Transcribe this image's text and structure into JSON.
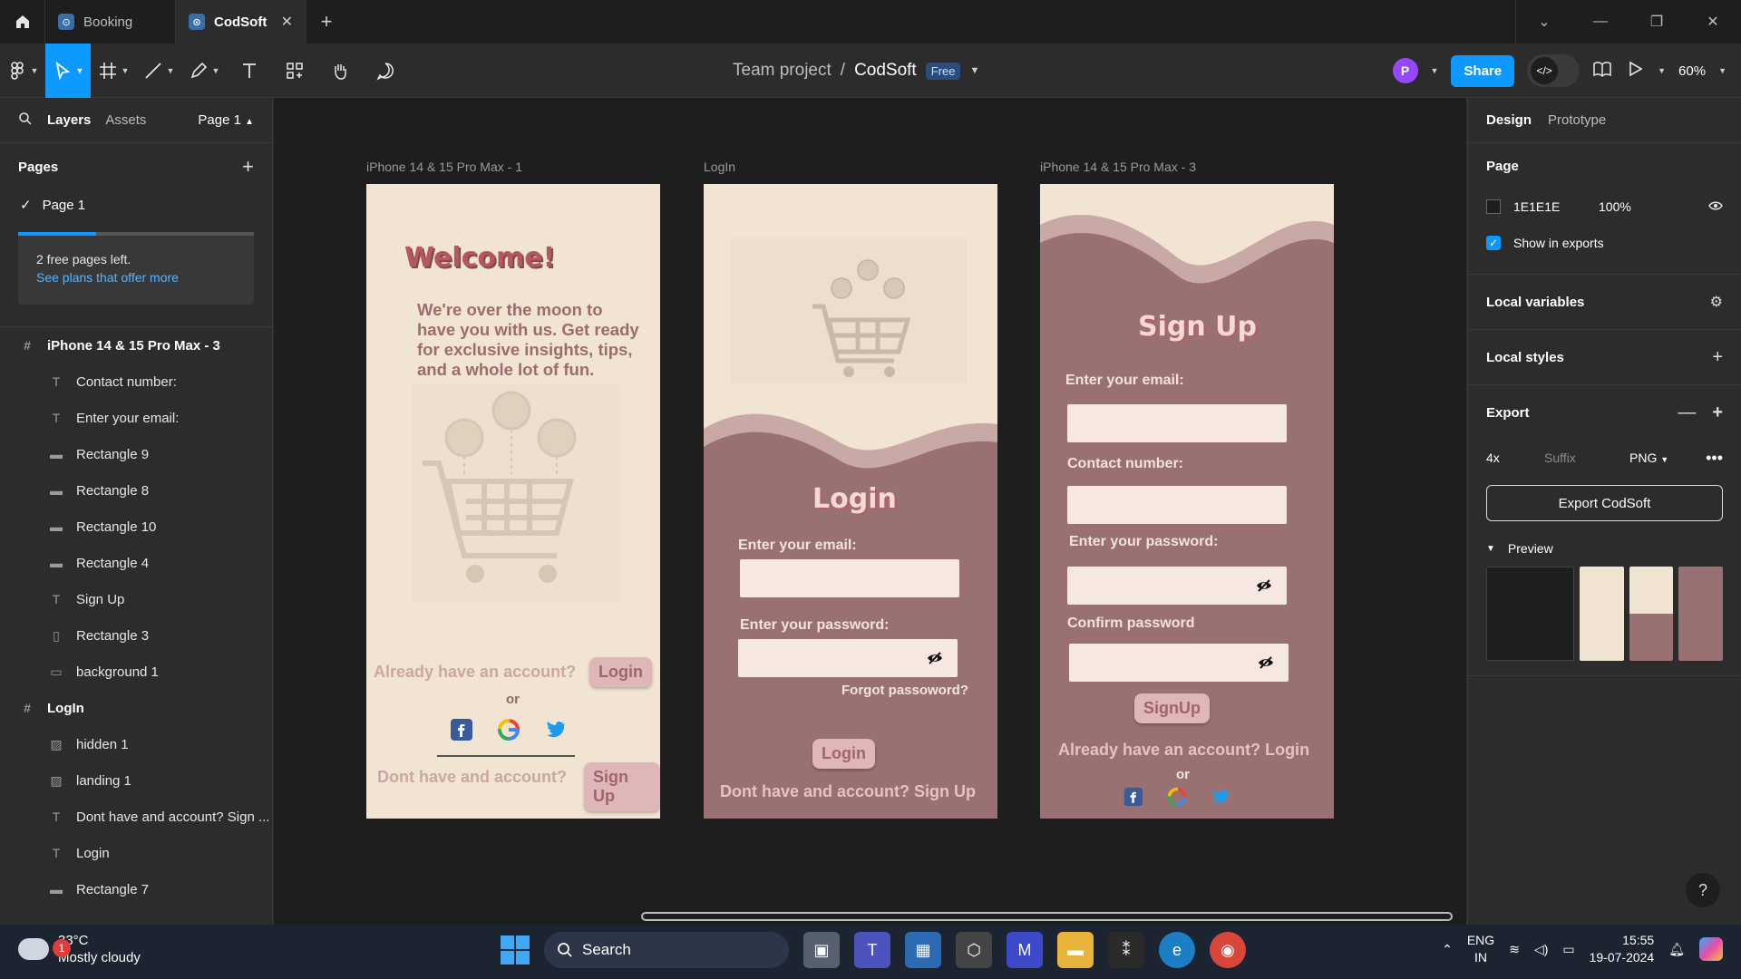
{
  "tabs": {
    "items": [
      {
        "label": "Booking"
      },
      {
        "label": "CodSoft"
      }
    ]
  },
  "breadcrumb": {
    "team": "Team project",
    "sep": "/",
    "file": "CodSoft",
    "plan": "Free"
  },
  "toolbar": {
    "share_label": "Share",
    "avatar_initial": "P",
    "zoom": "60%"
  },
  "left_panel": {
    "tabs": {
      "layers": "Layers",
      "assets": "Assets",
      "page": "Page 1"
    },
    "pages_heading": "Pages",
    "pages": [
      "Page 1"
    ],
    "free_box": {
      "line1": "2 free pages left.",
      "link": "See plans that offer more",
      "progress": 0.33
    },
    "layers": [
      {
        "label": "iPhone 14 & 15 Pro Max - 3",
        "kind": "frame"
      },
      {
        "label": "Contact number:",
        "kind": "text"
      },
      {
        "label": "Enter your email:",
        "kind": "text"
      },
      {
        "label": "Rectangle 9",
        "kind": "rect"
      },
      {
        "label": "Rectangle 8",
        "kind": "rect"
      },
      {
        "label": "Rectangle 10",
        "kind": "rect"
      },
      {
        "label": "Rectangle 4",
        "kind": "rect"
      },
      {
        "label": "Sign Up",
        "kind": "text"
      },
      {
        "label": "Rectangle 3",
        "kind": "vrect"
      },
      {
        "label": "background 1",
        "kind": "box"
      },
      {
        "label": "LogIn",
        "kind": "frame"
      },
      {
        "label": "hidden 1",
        "kind": "image"
      },
      {
        "label": "landing 1",
        "kind": "image"
      },
      {
        "label": "Dont have and account? Sign ...",
        "kind": "text"
      },
      {
        "label": "Login",
        "kind": "text"
      },
      {
        "label": "Rectangle 7",
        "kind": "rect"
      }
    ]
  },
  "canvas": {
    "frame1": {
      "label": "iPhone 14 & 15 Pro Max - 1",
      "welcome": "Welcome!",
      "body": "We're over the moon to have you with us. Get ready for exclusive insights, tips, and a whole lot of fun.",
      "have_account": "Already have an  account?",
      "login_btn": "Login",
      "or": "or",
      "no_account": "Dont have and account?",
      "signup_btn": "Sign Up"
    },
    "frame2": {
      "label": "LogIn",
      "title": "Login",
      "email_label": "Enter your email:",
      "password_label": "Enter your password:",
      "forgot": "Forgot passoword?",
      "login_btn": "Login",
      "bottom": "Dont have and account? Sign Up"
    },
    "frame3": {
      "label": "iPhone 14 & 15 Pro Max - 3",
      "title": "Sign Up",
      "email_label": "Enter your email:",
      "contact_label": "Contact number:",
      "password_label": "Enter your password:",
      "confirm_label": "Confirm password",
      "signup_btn": "SignUp",
      "bottom": "Already have an  account? Login",
      "or": "or"
    }
  },
  "right_panel": {
    "tabs": {
      "design": "Design",
      "prototype": "Prototype"
    },
    "page_heading": "Page",
    "page_color": "1E1E1E",
    "page_opacity": "100%",
    "show_in_exports": "Show in exports",
    "local_variables": "Local variables",
    "local_styles": "Local styles",
    "export_heading": "Export",
    "export_scale": "4x",
    "export_suffix": "Suffix",
    "export_format": "PNG",
    "export_button": "Export CodSoft",
    "preview_label": "Preview"
  },
  "taskbar": {
    "weather_temp": "33°C",
    "weather_desc": "Mostly cloudy",
    "weather_alerts": "1",
    "search_label": "Search",
    "lang1": "ENG",
    "lang2": "IN",
    "time": "15:55",
    "date": "19-07-2024"
  },
  "colors": {
    "accent": "#0d99ff",
    "canvas_bg": "#1e1e1e",
    "cream": "#f1e4d3",
    "mauve": "#9a7172",
    "rose": "#b7575b"
  }
}
